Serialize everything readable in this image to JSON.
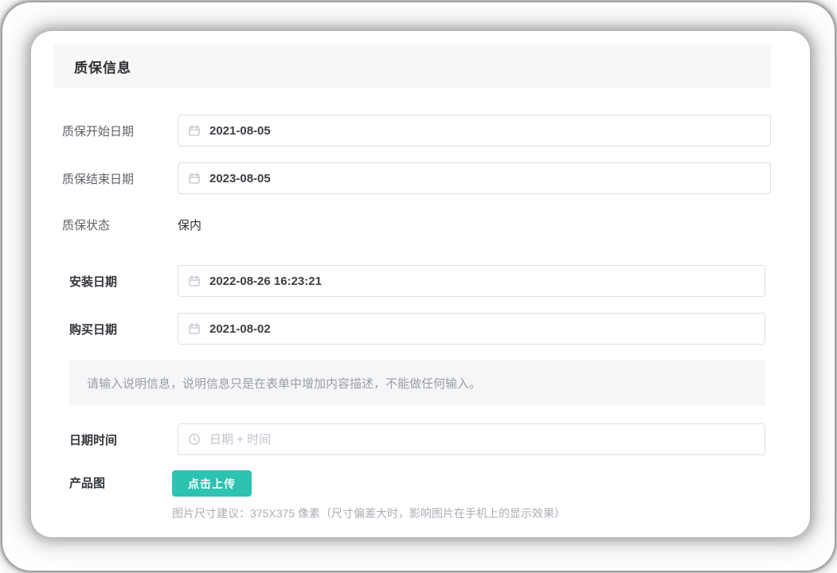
{
  "page": {
    "section_title": "质保信息",
    "form": {
      "warranty_start": {
        "label": "质保开始日期",
        "value": "2021-08-05",
        "icon": "calendar-icon"
      },
      "warranty_end": {
        "label": "质保结束日期",
        "value": "2023-08-05",
        "icon": "calendar-icon"
      },
      "warranty_status": {
        "label": "质保状态",
        "value": "保内"
      },
      "install_date": {
        "label": "安装日期",
        "value": "2022-08-26 16:23:21",
        "icon": "calendar-icon"
      },
      "purchase_date": {
        "label": "购买日期",
        "value": "2021-08-02",
        "icon": "calendar-icon"
      },
      "description_note": "请输入说明信息，说明信息只是在表单中增加内容描述，不能做任何输入。",
      "datetime": {
        "label": "日期时间",
        "placeholder": "日期 + 时间",
        "icon": "clock-icon"
      },
      "product_image": {
        "label": "产品图",
        "upload_button_label": "点击上传",
        "hint": "图片尺寸建议：375X375 像素（尺寸偏差大时，影响图片在手机上的显示效果）"
      }
    },
    "colors": {
      "accent": "#2cc3b1",
      "input_border": "#dcdfe6",
      "placeholder_text": "#c0c4cc",
      "header_bg": "#f7f7f8",
      "note_bg": "#f5f6f7"
    }
  }
}
